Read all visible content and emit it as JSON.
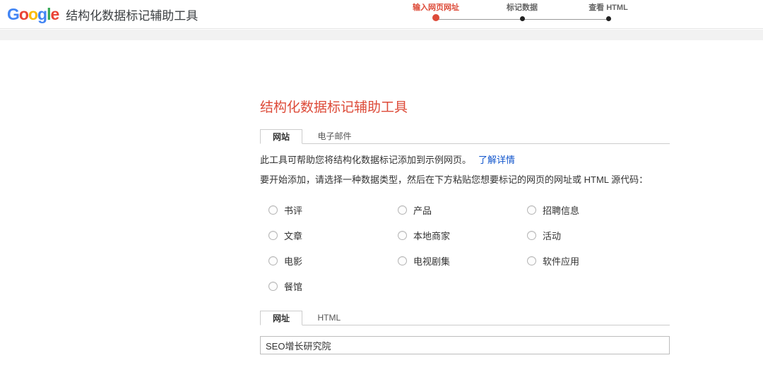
{
  "header": {
    "logo_letters": [
      {
        "ch": "G",
        "color": "#4285F4"
      },
      {
        "ch": "o",
        "color": "#EA4335"
      },
      {
        "ch": "o",
        "color": "#FBBC05"
      },
      {
        "ch": "g",
        "color": "#4285F4"
      },
      {
        "ch": "l",
        "color": "#34A853"
      },
      {
        "ch": "e",
        "color": "#EA4335"
      }
    ],
    "title": "结构化数据标记辅助工具",
    "steps": [
      {
        "label": "输入网页网址",
        "active": true
      },
      {
        "label": "标记数据",
        "active": false
      },
      {
        "label": "查看 HTML",
        "active": false
      }
    ]
  },
  "main": {
    "heading": "结构化数据标记辅助工具",
    "tabs": [
      {
        "label": "网站"
      },
      {
        "label": "电子邮件"
      }
    ],
    "intro_text": "此工具可帮助您将结构化数据标记添加到示例网页。",
    "learn_more_label": "了解详情",
    "instruction": "要开始添加，请选择一种数据类型，然后在下方粘贴您想要标记的网页的网址或 HTML 源代码：",
    "data_types": [
      "书评",
      "产品",
      "招聘信息",
      "文章",
      "本地商家",
      "活动",
      "电影",
      "电视剧集",
      "软件应用",
      "餐馆"
    ],
    "source_tabs": [
      {
        "label": "网址"
      },
      {
        "label": "HTML"
      }
    ],
    "url_input_value": "SEO增长研究院"
  },
  "colors": {
    "accent_red": "#dd4b39",
    "link_blue": "#1155cc",
    "step_inactive": "#666666"
  }
}
